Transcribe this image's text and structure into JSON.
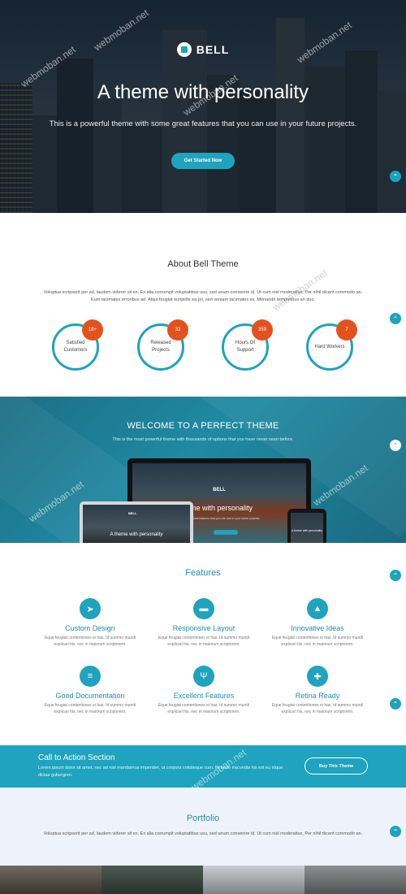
{
  "hero": {
    "logo": "BELL",
    "title": "A theme with personality",
    "subtitle": "This is a powerful theme with some great features that you can use in your future projects.",
    "cta": "Get Started Now"
  },
  "about": {
    "title": "About Bell Theme",
    "text": "Voluptua scripserit per ad, laudem viderer sit ex. Ex alia corrumpit voluptatibus usu, sed unum convenire id. Ut cum nisl moderatius, Per nihil dicant commodo an. Eum tacimates erroribus ad. Atqui feugiat euripidis ea pri, sed veniam tacimates ex. Menandri temporibus an duo.",
    "stats": [
      {
        "num": "18+",
        "label": "Satisfied Customers"
      },
      {
        "num": "32",
        "label": "Released Projects"
      },
      {
        "num": "359",
        "label": "Hours Of Support"
      },
      {
        "num": "7",
        "label": "Hard Workers"
      }
    ]
  },
  "welcome": {
    "title": "WELCOME TO A PERFECT THEME",
    "subtitle": "This is the most powerful theme with thousands of options that you have never seen before.",
    "mock_logo": "BELL",
    "mock_title": "eme with personality",
    "mock_sub": "with some great features that you can use in your future projects.",
    "laptop_title": "A theme with personality",
    "laptop_logo": "BELL",
    "phone_text": "A theme with personality"
  },
  "features": {
    "title": "Features",
    "items": [
      {
        "icon": "rocket-icon",
        "glyph": "➤",
        "title": "Custom Design",
        "text": "Eque feugiat contentiones ei has. Id summo mundi explicari his, nec in maiorum scriptorem."
      },
      {
        "icon": "layout-icon",
        "glyph": "▬",
        "title": "Responsive Layout",
        "text": "Eque feugiat contentiones ei has. Id summo mundi explicari his, nec in maiorum scriptorem."
      },
      {
        "icon": "bell-icon",
        "glyph": "▲",
        "title": "Innovative Ideas",
        "text": "Eque feugiat contentiones ei has. Id summo mundi explicari his, nec in maiorum scriptorem."
      },
      {
        "icon": "document-icon",
        "glyph": "≡",
        "title": "Good Documentation",
        "text": "Eque feugiat contentiones ei has. Id summo mundi explicari his, nec in maiorum scriptorem."
      },
      {
        "icon": "cutlery-icon",
        "glyph": "Ψ",
        "title": "Excellent Features",
        "text": "Eque feugiat contentiones ei has. Id summo mundi explicari his, nec in maiorum scriptorem."
      },
      {
        "icon": "gift-icon",
        "glyph": "✚",
        "title": "Retina Ready",
        "text": "Eque feugiat contentiones ei has. Id summo mundi explicari his, nec in maiorum scriptorem."
      }
    ]
  },
  "cta": {
    "title": "Call to Action Section",
    "text": "Lorem ipsum dolor sit amet, nec ad nisl mandamus imperdiet, ut corpora cotidieque cum. Et brute iracundia his est eu idque dictas gubergren.",
    "button": "Buy This Theme"
  },
  "portfolio": {
    "title": "Portfolio",
    "text": "Voluptua scripserit per ad, laudem viderer sit ex. Ex alia corrumpit voluptatibus usu, sed unum convenire id. Ut cum nisl moderatius, Per nihil dicant commodo an."
  },
  "watermark": "webmoban.net",
  "colors": {
    "accent": "#1fa3be",
    "badge": "#e3521d"
  }
}
